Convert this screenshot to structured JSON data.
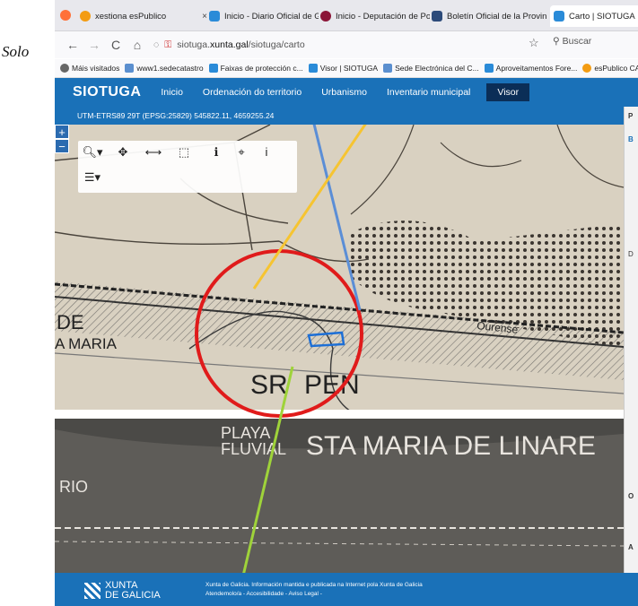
{
  "outside_label": "Solo",
  "browser": {
    "tabs": [
      {
        "label": "xestiona esPublico",
        "color": "#f39c12"
      },
      {
        "label": "Inicio - Diario Oficial de G",
        "color": "#2a8bd8"
      },
      {
        "label": "Inicio - Deputación de Po",
        "color": "#8b1538"
      },
      {
        "label": "Boletín Oficial de la Provin",
        "color": "#2c4a7a"
      },
      {
        "label": "Carto | SIOTUGA",
        "color": "#2a8bd8"
      }
    ],
    "url_prefix": "siotuga.",
    "url_domain": "xunta.gal",
    "url_path": "/siotuga/carto",
    "search_placeholder": "Buscar",
    "bookmarks": [
      "Máis visitados",
      "www1.sedecatastro",
      "Faixas de protección c...",
      "Visor | SIOTUGA",
      "Sede Electrónica del C...",
      "Aproveitamentos Fore...",
      "esPublico CAT"
    ]
  },
  "app": {
    "logo": "SIOTUGA",
    "menu": [
      "Inicio",
      "Ordenación do territorio",
      "Urbanismo",
      "Inventario municipal"
    ],
    "visor": "Visor",
    "coords": "UTM-ETRS89 29T (EPSG:25829) 545822.11, 4659255.24",
    "panel_letters": [
      "P",
      "B",
      "D",
      "O",
      "A"
    ]
  },
  "map": {
    "labels": [
      "DE",
      "A MARIA",
      "SR",
      "PEN",
      "PLAYA",
      "FLUVIAL",
      "STA MARIA DE LINARE",
      "RIO",
      "Ourense"
    ]
  },
  "footer": {
    "brand_line1": "XUNTA",
    "brand_line2": "DE GALICIA",
    "text1": "Xunta de Galicia. Información mantida e publicada na Internet pola Xunta de Galicia",
    "text2": "Atendemolo/a - Accesibilidade - Aviso Legal -"
  }
}
